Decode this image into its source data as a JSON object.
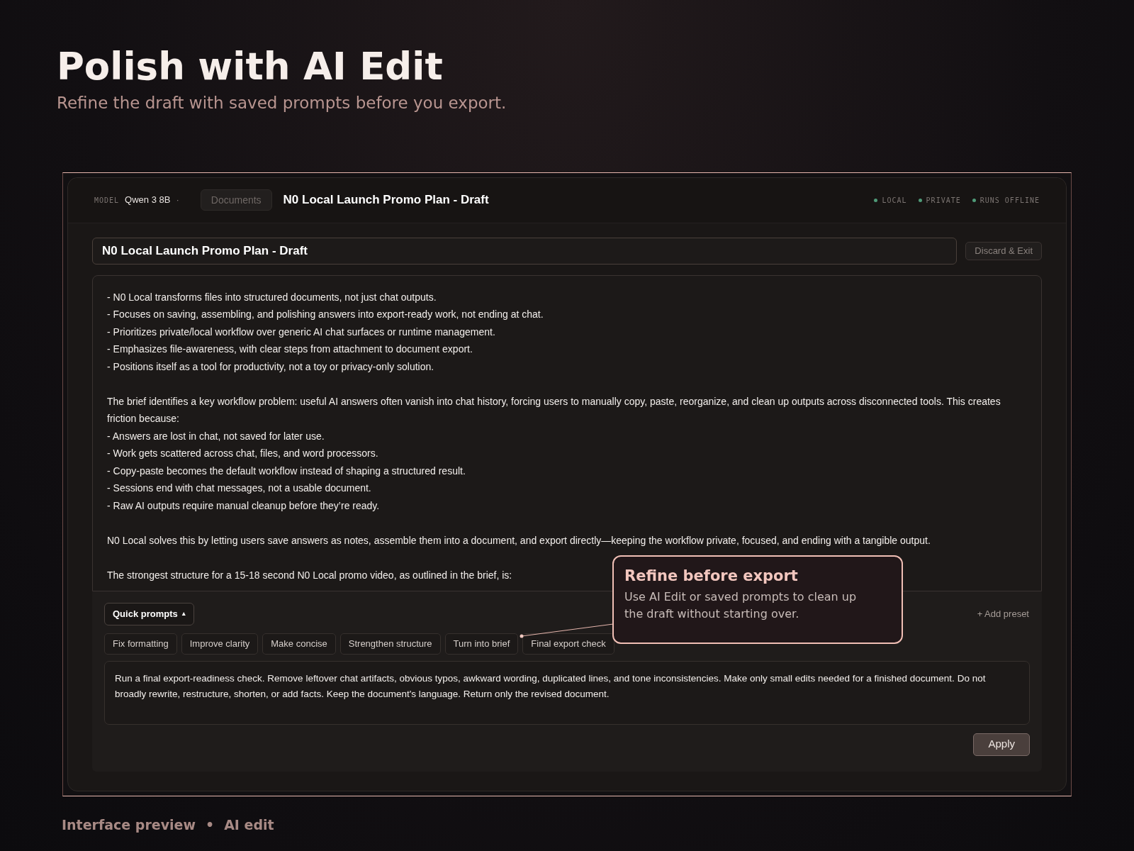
{
  "hero": {
    "title": "Polish with AI Edit",
    "subtitle": "Refine the draft with saved prompts before you export."
  },
  "header": {
    "model_label": "MODEL",
    "model": "Qwen 3 8B",
    "model_caret": "·",
    "documents_button": "Documents",
    "doc_title": "N0 Local Launch Promo Plan - Draft",
    "badges": [
      "LOCAL",
      "PRIVATE",
      "RUNS OFFLINE"
    ]
  },
  "editor": {
    "title_value": "N0 Local Launch Promo Plan - Draft",
    "discard_button": "Discard & Exit",
    "paragraphs": [
      [
        "- N0 Local transforms files into structured documents, not just chat outputs.",
        "- Focuses on saving, assembling, and polishing answers into export-ready work, not ending at chat.",
        "- Prioritizes private/local workflow over generic AI chat surfaces or runtime management.",
        "- Emphasizes file-awareness, with clear steps from attachment to document export.",
        "- Positions itself as a tool for productivity, not a toy or privacy-only solution."
      ],
      [
        "The brief identifies a key workflow problem: useful AI answers often vanish into chat history, forcing users to manually copy, paste, reorganize, and clean up outputs across disconnected tools. This creates friction because:",
        "- Answers are lost in chat, not saved for later use.",
        "- Work gets scattered across chat, files, and word processors.",
        "- Copy-paste becomes the default workflow instead of shaping a structured result.",
        "- Sessions end with chat messages, not a usable document.",
        "- Raw AI outputs require manual cleanup before they’re ready."
      ],
      [
        "N0 Local solves this by letting users save answers as notes, assemble them into a document, and export directly—keeping the workflow private, focused, and ending with a tangible output."
      ],
      [
        "The strongest structure for a 15-18 second N0 Local promo video, as outlined in the brief, is:"
      ]
    ]
  },
  "prompts": {
    "toggle": "Quick prompts",
    "toggle_caret": "▴",
    "expanded": true,
    "add_preset": "+ Add preset",
    "chips": [
      "Fix formatting",
      "Improve clarity",
      "Make concise",
      "Strengthen structure",
      "Turn into brief",
      "Final export check"
    ],
    "prompt_text": "Run a final export-readiness check. Remove leftover chat artifacts, obvious typos, awkward wording, duplicated lines, and tone inconsistencies. Make only small edits needed for a finished document. Do not broadly rewrite, restructure, shorten, or add facts. Keep the document's language. Return only the revised document.",
    "apply_button": "Apply"
  },
  "callout": {
    "title": "Refine before export",
    "text": "Use AI Edit or saved prompts to clean up the draft without starting over."
  },
  "footer": {
    "left": "Interface preview",
    "separator": "•",
    "right": "AI edit"
  }
}
